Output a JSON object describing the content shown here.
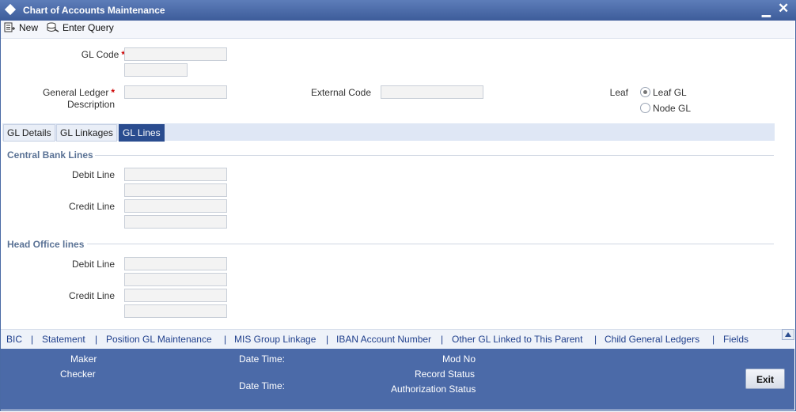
{
  "window": {
    "title": "Chart of Accounts Maintenance",
    "minimize": "▁",
    "close": "✕"
  },
  "toolbar": {
    "new_label": "New",
    "enter_query_label": "Enter Query"
  },
  "form": {
    "gl_code_label": "GL Code",
    "gl_code_value": "",
    "gl_code_extra_value": "",
    "gl_desc_label_line1": "General Ledger",
    "gl_desc_label_line2": "Description",
    "gl_desc_value": "",
    "external_code_label": "External Code",
    "external_code_value": "",
    "leaf_label": "Leaf",
    "leaf_options": [
      {
        "label": "Leaf GL",
        "selected": true
      },
      {
        "label": "Node GL",
        "selected": false
      }
    ],
    "required_mark": "*"
  },
  "tabs": [
    {
      "label": "GL Details",
      "active": false
    },
    {
      "label": "GL Linkages",
      "active": false
    },
    {
      "label": "GL Lines",
      "active": true
    }
  ],
  "central_bank": {
    "title": "Central Bank Lines",
    "debit_label": "Debit Line",
    "credit_label": "Credit Line"
  },
  "head_office": {
    "title": "Head Office lines",
    "debit_label": "Debit Line",
    "credit_label": "Credit Line"
  },
  "links": [
    "BIC",
    "Statement",
    "Position GL Maintenance",
    "MIS Group Linkage",
    "IBAN Account Number",
    "Other GL Linked to This Parent",
    "Child General Ledgers",
    "Fields"
  ],
  "link_separator": "|",
  "footer": {
    "maker": "Maker",
    "checker": "Checker",
    "date_time": "Date Time:",
    "mod_no": "Mod No",
    "record_status": "Record Status",
    "authorization_status": "Authorization Status",
    "exit": "Exit"
  },
  "colors": {
    "titlebar": "#3d5c9a",
    "footer": "#4b6aa8",
    "active_tab": "#2a4c8f",
    "link": "#1f3f8c"
  }
}
